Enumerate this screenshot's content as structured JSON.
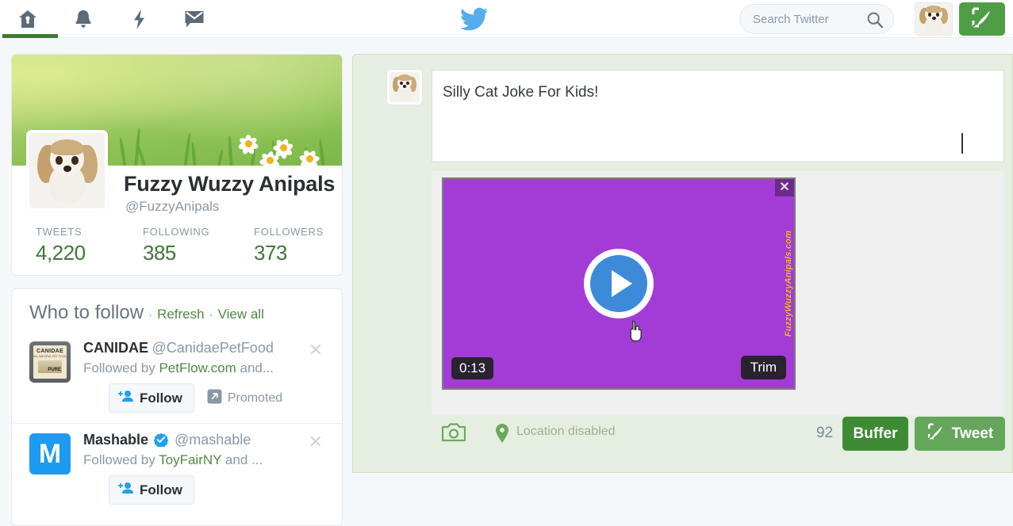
{
  "topnav": {
    "icons": [
      {
        "name": "home-icon",
        "label": "Home"
      },
      {
        "name": "bell-icon",
        "label": "Notifications"
      },
      {
        "name": "bolt-icon",
        "label": "Moments"
      },
      {
        "name": "envelope-icon",
        "label": "Messages"
      }
    ],
    "brand": "twitter-bird-logo",
    "search": {
      "placeholder": "Search Twitter",
      "value": "",
      "icon": "search-icon"
    },
    "avatar_alt": "profile-avatar",
    "compose_icon": "quill-compose-icon",
    "active_index": 0,
    "accent_green": "#3d7a34"
  },
  "profile": {
    "name": "Fuzzy Wuzzy Anipals",
    "handle": "@FuzzyAnipals",
    "stats": [
      {
        "label": "TWEETS",
        "value": "4,220"
      },
      {
        "label": "FOLLOWING",
        "value": "385"
      },
      {
        "label": "FOLLOWERS",
        "value": "373"
      }
    ],
    "stat_color": "#3d7a34"
  },
  "who_to_follow": {
    "title": "Who to follow",
    "sep": "·",
    "refresh": "Refresh",
    "view_all": "View all",
    "rows": [
      {
        "name": "CANIDAE",
        "handle": "@CanidaePetFood",
        "verified": false,
        "followed_prefix": "Followed by",
        "followed_by": "PetFlow.com",
        "followed_suffix": "and...",
        "follow_label": "Follow",
        "promoted_label": "Promoted",
        "avatar": "canidae-brand-avatar",
        "dismiss_icon": "close-icon"
      },
      {
        "name": "Mashable",
        "handle": "@mashable",
        "verified": true,
        "followed_prefix": "Followed by",
        "followed_by": "ToyFairNY",
        "followed_suffix": "and ...",
        "follow_label": "Follow",
        "promoted_label": "",
        "avatar": "mashable-m-avatar",
        "dismiss_icon": "close-icon"
      }
    ]
  },
  "composer": {
    "avatar_alt": "composer-avatar",
    "tweet_text": "Silly Cat Joke For Kids! ",
    "video": {
      "duration": "0:13",
      "trim_label": "Trim",
      "close_icon": "close-icon",
      "play_icon": "play-icon",
      "watermark": "FuzzyWuzzyAnipals.com",
      "background_color": "#a33cd6",
      "watermark_color": "#f5c518"
    },
    "footer": {
      "camera_icon": "camera-icon",
      "location_icon": "location-pin-icon",
      "location_text": "Location disabled",
      "char_count": "92",
      "buffer_label": "Buffer",
      "tweet_label": "Tweet",
      "tweet_icon": "quill-compose-icon",
      "buffer_color": "#3d8b35",
      "tweet_color": "#64a65a"
    }
  }
}
